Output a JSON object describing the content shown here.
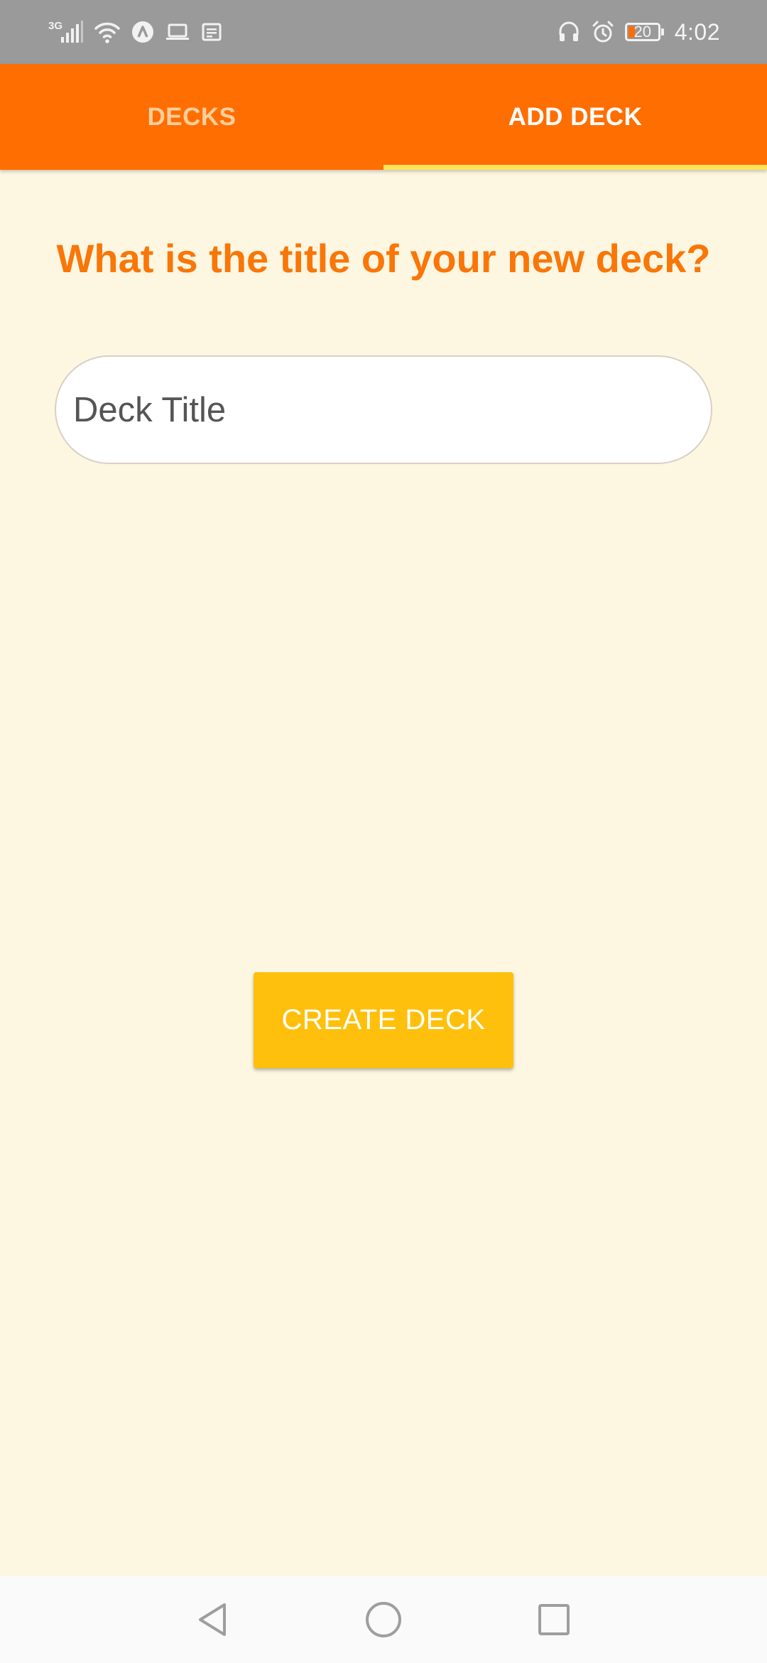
{
  "status_bar": {
    "network_type": "3G",
    "time": "4:02",
    "battery_level": "20",
    "left_icons": [
      "signal-icon",
      "wifi-icon",
      "app-a-icon",
      "laptop-icon",
      "notes-icon"
    ],
    "right_icons": [
      "headset-icon",
      "alarm-icon",
      "battery-icon"
    ]
  },
  "tabs": [
    {
      "label": "DECKS",
      "active": false
    },
    {
      "label": "ADD DECK",
      "active": true
    }
  ],
  "form": {
    "question": "What is the title of your new deck?",
    "title_placeholder": "Deck Title",
    "title_value": "",
    "submit_label": "CREATE DECK"
  },
  "nav_bar": {
    "buttons": [
      "back-icon",
      "home-icon",
      "recents-icon"
    ]
  },
  "colors": {
    "primary": "#ff6e00",
    "background": "#fdf6e1",
    "accent": "#fec00c",
    "tab_indicator": "#ffe35a",
    "question_text": "#f97608",
    "inactive_tab_text": "#ffcf9d"
  }
}
